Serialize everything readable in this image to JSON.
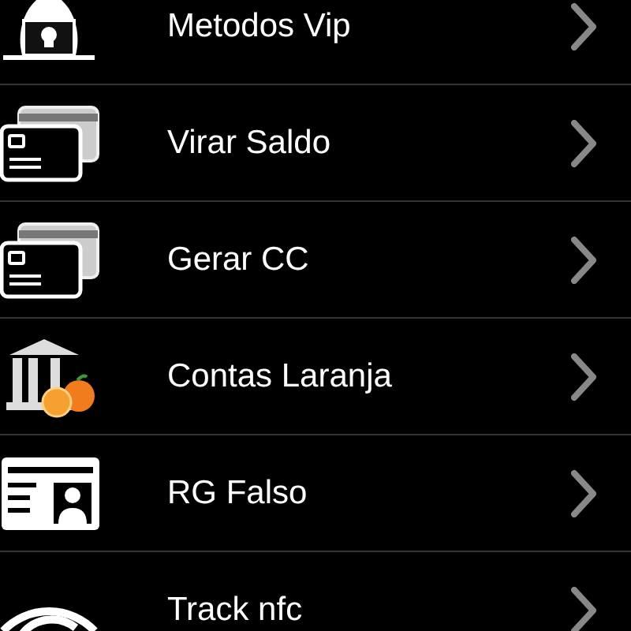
{
  "menu": [
    {
      "kind": "hacker",
      "label": "Metodos Vip"
    },
    {
      "kind": "cards",
      "label": "Virar Saldo"
    },
    {
      "kind": "cards",
      "label": "Gerar CC"
    },
    {
      "kind": "bank",
      "label": "Contas Laranja"
    },
    {
      "kind": "idcard",
      "label": "RG Falso"
    },
    {
      "kind": "signal",
      "label": "Track nfc"
    }
  ]
}
